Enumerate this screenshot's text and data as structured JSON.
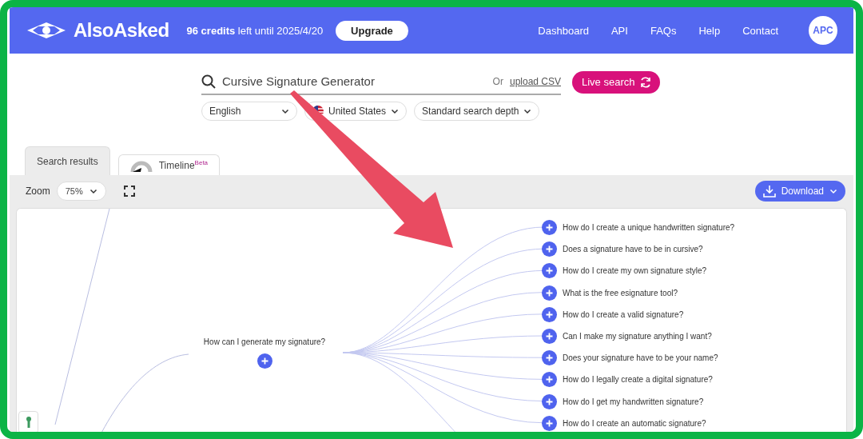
{
  "header": {
    "logo": "AlsoAsked",
    "credits": "**96 credits** left until 2025/4/20",
    "upgrade": "Upgrade",
    "nav": [
      "Dashboard",
      "API",
      "FAQs",
      "Help",
      "Contact"
    ],
    "avatar": "APC"
  },
  "search": {
    "value": "Cursive Signature Generator",
    "or": "Or",
    "upload_link": "upload CSV",
    "button": "Live search"
  },
  "filters": [
    {
      "label": "English",
      "kind": "plain"
    },
    {
      "label": "United States",
      "kind": "flag"
    },
    {
      "label": "Standard search depth",
      "kind": "plain"
    }
  ],
  "tabs": [
    {
      "label": "Search results",
      "selected": true
    },
    {
      "label": "Timeline",
      "badge": "Beta",
      "selected": false
    }
  ],
  "toolbar": {
    "zoom_label": "Zoom",
    "zoom_value": "75%",
    "download": "Download"
  },
  "map": {
    "root": "How can I generate my signature?",
    "questions": [
      "How do I create a unique handwritten signature?",
      "Does a signature have to be in cursive?",
      "How do I create my own signature style?",
      "What is the free esignature tool?",
      "How do I create a valid signature?",
      "Can I make my signature anything I want?",
      "Does your signature have to be your name?",
      "How do I legally create a digital signature?",
      "How do I get my handwritten signature?",
      "How do I create an automatic signature?"
    ]
  }
}
